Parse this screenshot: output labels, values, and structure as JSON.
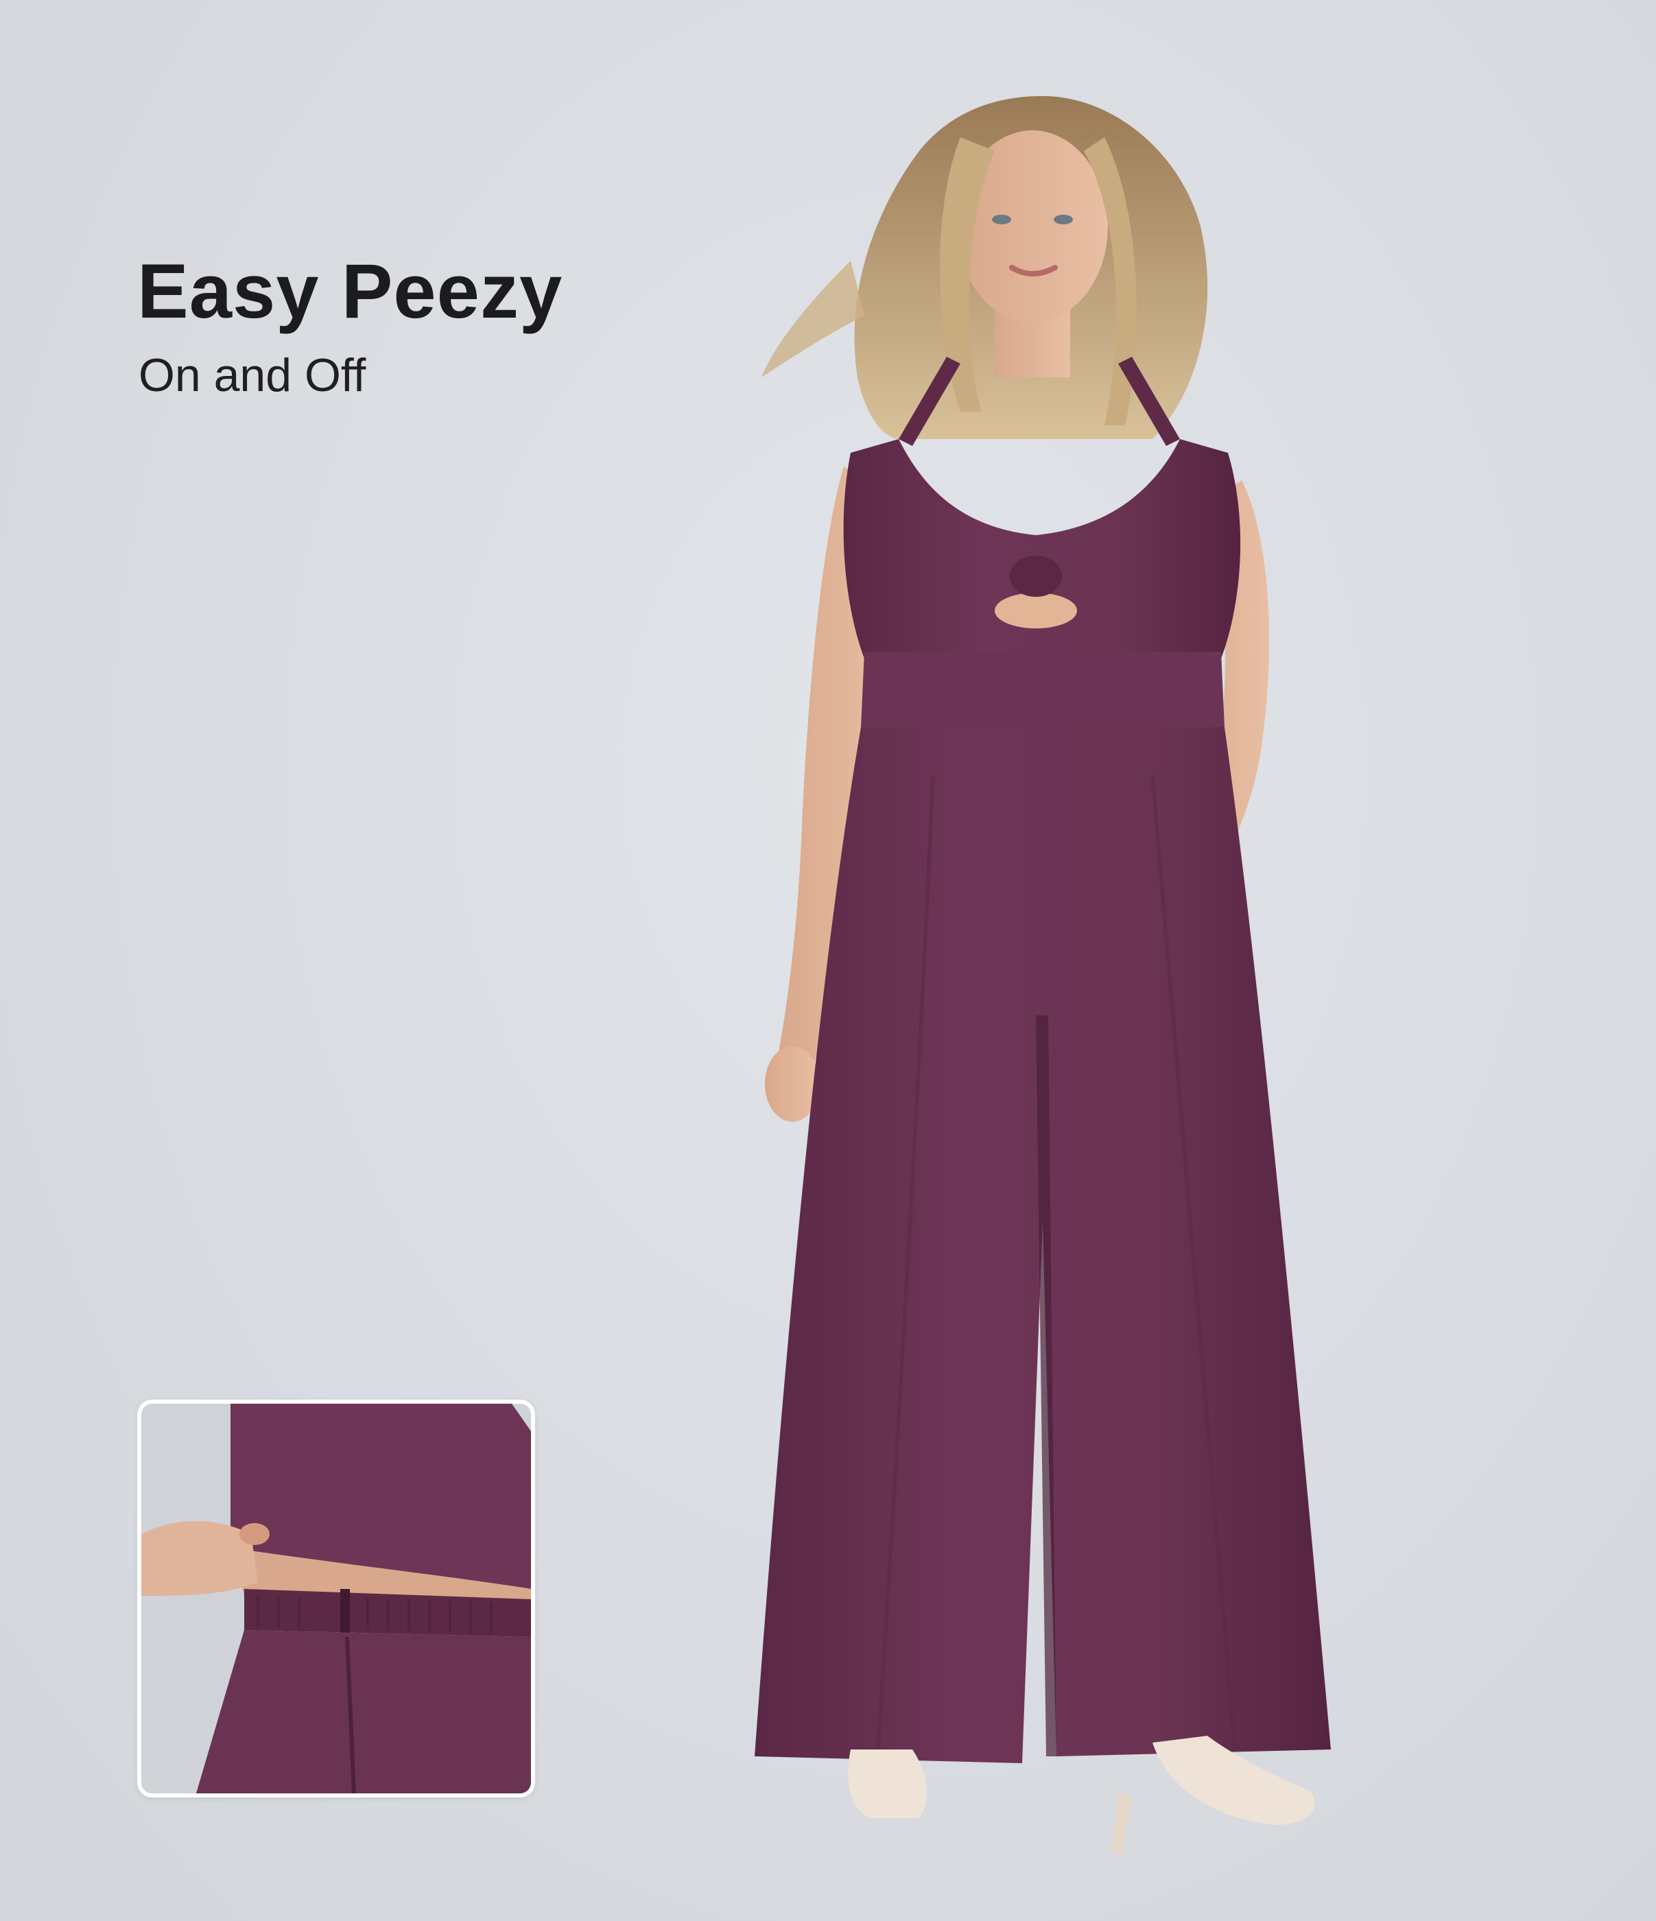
{
  "headline": "Easy Peezy",
  "subheadline": "On and Off",
  "colors": {
    "background": "#dadde2",
    "garment": "#6a3352",
    "text": "#1c1c1e",
    "inset_border": "#ffffff"
  },
  "images": {
    "model": "model-in-plum-wide-leg-jumpsuit",
    "detail": "detail-elastic-waistband-closeup"
  }
}
